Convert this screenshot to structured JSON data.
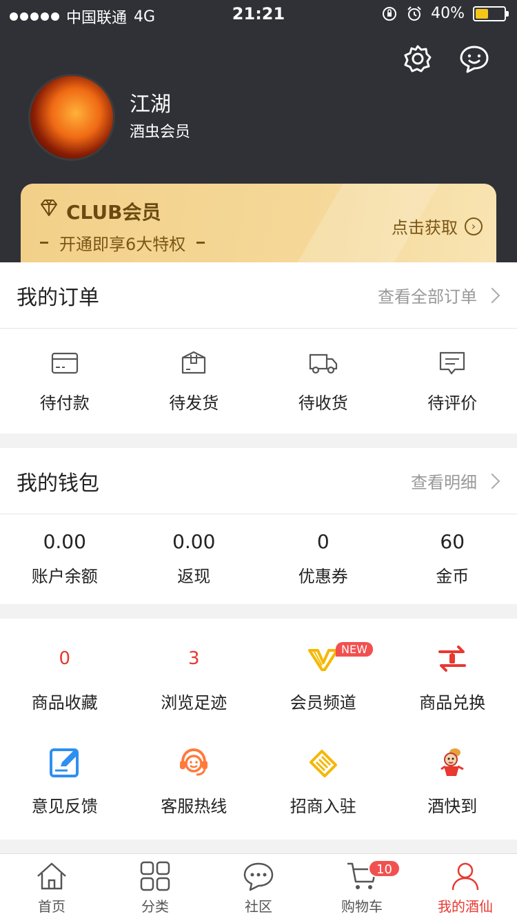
{
  "status_bar": {
    "carrier": "中国联通",
    "network": "4G",
    "time": "21:21",
    "battery": "40%",
    "battery_level": 0.4
  },
  "header": {
    "icons": [
      "settings-icon",
      "message-icon"
    ]
  },
  "user": {
    "name": "江湖",
    "level": "酒虫会员"
  },
  "club": {
    "title": "CLUB会员",
    "subtitle": "开通即享6大特权",
    "cta": "点击获取"
  },
  "orders": {
    "title": "我的订单",
    "link": "查看全部订单",
    "items": [
      {
        "label": "待付款",
        "icon": "card-icon"
      },
      {
        "label": "待发货",
        "icon": "package-icon"
      },
      {
        "label": "待收货",
        "icon": "truck-icon"
      },
      {
        "label": "待评价",
        "icon": "comment-icon"
      }
    ]
  },
  "wallet": {
    "title": "我的钱包",
    "link": "查看明细",
    "items": [
      {
        "value": "0.00",
        "label": "账户余额"
      },
      {
        "value": "0.00",
        "label": "返现"
      },
      {
        "value": "0",
        "label": "优惠券"
      },
      {
        "value": "60",
        "label": "金币"
      }
    ]
  },
  "tools": {
    "row1": [
      {
        "count": "0",
        "label": "商品收藏"
      },
      {
        "count": "3",
        "label": "浏览足迹"
      },
      {
        "label": "会员频道",
        "badge": "NEW",
        "icon": "vip-icon"
      },
      {
        "label": "商品兑换",
        "icon": "exchange-icon"
      }
    ],
    "row2": [
      {
        "label": "意见反馈",
        "icon": "feedback-icon"
      },
      {
        "label": "客服热线",
        "icon": "service-icon"
      },
      {
        "label": "招商入驻",
        "icon": "handshake-icon"
      },
      {
        "label": "酒快到",
        "icon": "mascot-icon"
      }
    ]
  },
  "tabbar": {
    "tabs": [
      {
        "label": "首页",
        "icon": "home-icon"
      },
      {
        "label": "分类",
        "icon": "grid-icon"
      },
      {
        "label": "社区",
        "icon": "chat-icon"
      },
      {
        "label": "购物车",
        "icon": "cart-icon",
        "badge": "10"
      },
      {
        "label": "我的酒仙",
        "icon": "user-icon",
        "active": true
      }
    ]
  },
  "colors": {
    "header_bg": "#2f3137",
    "accent_red": "#e8382f",
    "gold": "#f2d089"
  }
}
